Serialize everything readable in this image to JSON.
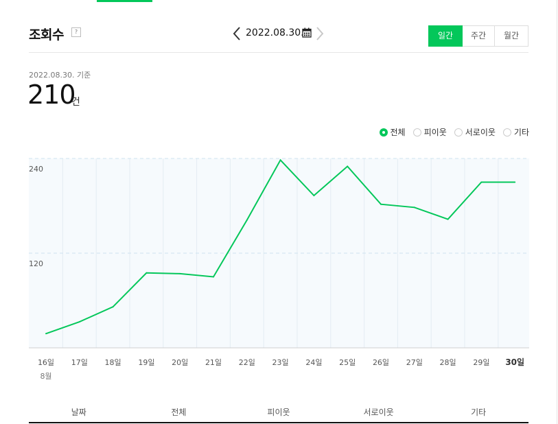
{
  "header": {
    "title": "조회수",
    "help_label": "?"
  },
  "date_nav": {
    "current_date": "2022.08.30.",
    "prev_icon": "chevron-left-icon",
    "next_icon": "chevron-right-icon",
    "calendar_icon": "calendar-icon"
  },
  "period_tabs": [
    {
      "label": "일간",
      "active": true
    },
    {
      "label": "주간",
      "active": false
    },
    {
      "label": "월간",
      "active": false
    }
  ],
  "summary": {
    "basis_label": "2022.08.30. 기준",
    "value": "210",
    "unit": "건"
  },
  "legend": [
    {
      "label": "전체",
      "selected": true
    },
    {
      "label": "피이웃",
      "selected": false
    },
    {
      "label": "서로이웃",
      "selected": false
    },
    {
      "label": "기타",
      "selected": false
    }
  ],
  "chart_data": {
    "type": "line",
    "x": [
      "16일",
      "17일",
      "18일",
      "19일",
      "20일",
      "21일",
      "22일",
      "23일",
      "24일",
      "25일",
      "26일",
      "27일",
      "28일",
      "29일",
      "30일"
    ],
    "month_label": "8월",
    "series": [
      {
        "values": [
          18,
          33,
          52,
          95,
          94,
          90,
          162,
          238,
          193,
          230,
          182,
          178,
          163,
          210,
          210
        ]
      }
    ],
    "y_ticks": [
      120,
      240
    ],
    "ylim": [
      0,
      240
    ],
    "highlight_x": "30일",
    "grid": true,
    "line_color": "#03c75a",
    "background_color": "#f6fafd"
  },
  "table": {
    "columns": [
      "날짜",
      "전체",
      "피이웃",
      "서로이웃",
      "기타"
    ]
  },
  "colors": {
    "accent": "#03c75a"
  }
}
